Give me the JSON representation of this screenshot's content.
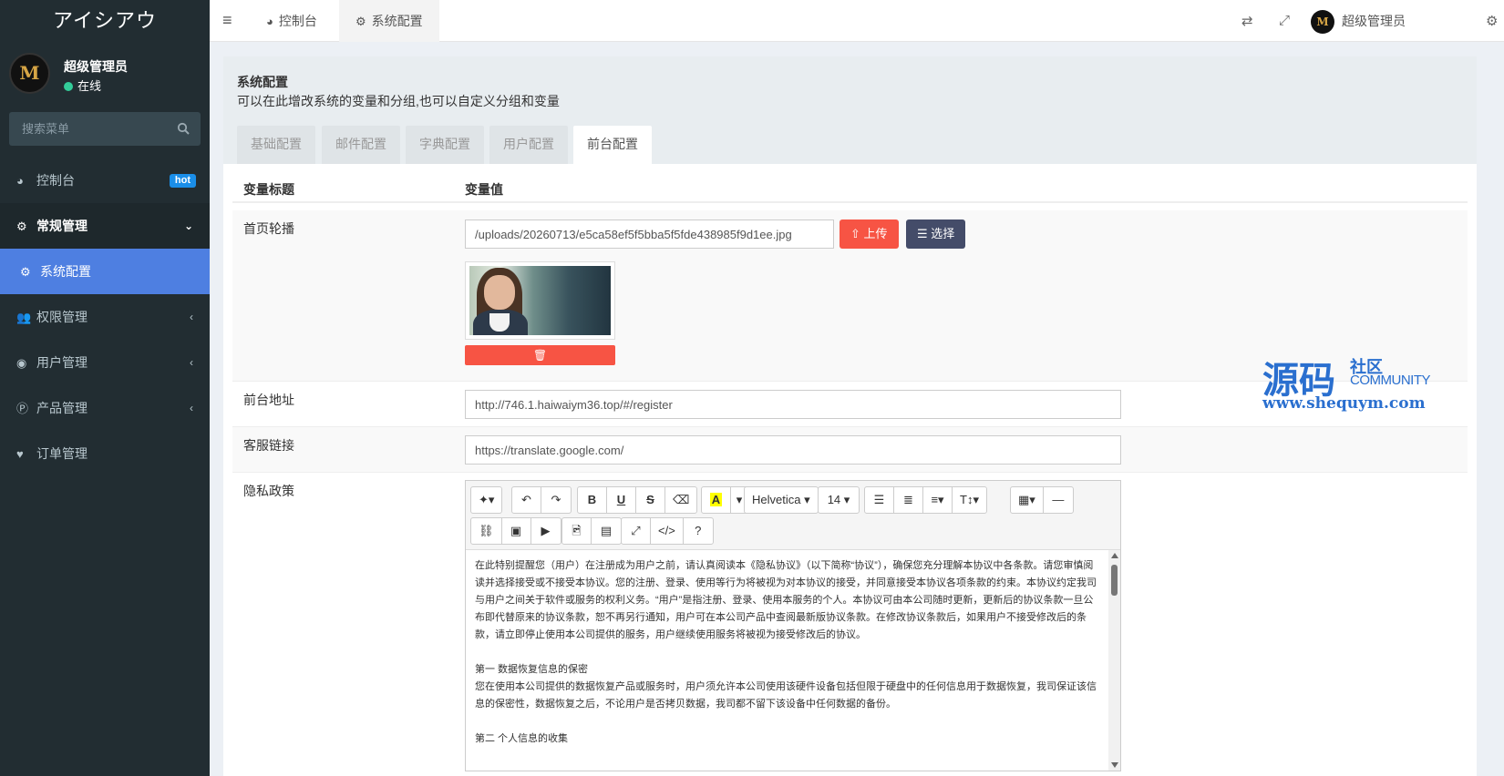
{
  "sidebar": {
    "app_title": "アイシアウ",
    "avatar_text": "M",
    "user_name": "超级管理员",
    "status": "在线",
    "search_placeholder": "搜索菜单",
    "items": [
      {
        "label": "控制台",
        "icon": "dashboard-icon",
        "badge": "hot"
      },
      {
        "label": "常规管理",
        "icon": "cogs-icon"
      },
      {
        "label": "系统配置",
        "icon": "gear-icon"
      },
      {
        "label": "权限管理",
        "icon": "users-icon"
      },
      {
        "label": "用户管理",
        "icon": "user-circle-icon"
      },
      {
        "label": "产品管理",
        "icon": "product-icon"
      },
      {
        "label": "订单管理",
        "icon": "heartbeat-icon"
      }
    ]
  },
  "topbar": {
    "tabs": [
      {
        "label": "控制台",
        "icon": "dashboard-icon"
      },
      {
        "label": "系统配置",
        "icon": "gear-icon"
      }
    ],
    "user_name": "超级管理员",
    "avatar_text": "M"
  },
  "panel": {
    "title": "系统配置",
    "description": "可以在此增改系统的变量和分组,也可以自定义分组和变量",
    "tabs": [
      "基础配置",
      "邮件配置",
      "字典配置",
      "用户配置",
      "前台配置"
    ],
    "active_tab": "前台配置"
  },
  "table": {
    "col_title": "变量标题",
    "col_value": "变量值",
    "rows": {
      "banner": {
        "label": "首页轮播",
        "value": "/uploads/20260713/e5ca58ef5f5bba5f5fde438985f9d1ee.jpg",
        "upload_label": "上传",
        "select_label": "选择"
      },
      "frontend_url": {
        "label": "前台地址",
        "value": "http://746.1.haiwaiym36.top/#/register"
      },
      "service_link": {
        "label": "客服链接",
        "value": "https://translate.google.com/"
      },
      "privacy": {
        "label": "隐私政策",
        "editor": {
          "font_name": "Helvetica",
          "font_size": "14",
          "paragraphs": [
            "在此特别提醒您（用户）在注册成为用户之前，请认真阅读本《隐私协议》（以下简称“协议”），确保您充分理解本协议中各条款。请您审慎阅读并选择接受或不接受本协议。您的注册、登录、使用等行为将被视为对本协议的接受，并同意接受本协议各项条款的约束。本协议约定我司与用户之间关于软件或服务的权利义务。“用户”是指注册、登录、使用本服务的个人。本协议可由本公司随时更新，更新后的协议条款一旦公布即代替原来的协议条款，恕不再另行通知，用户可在本公司产品中查阅最新版协议条款。在修改协议条款后，如果用户不接受修改后的条款，请立即停止使用本公司提供的服务，用户继续使用服务将被视为接受修改后的协议。",
            "",
            "第一 数据恢复信息的保密",
            "您在使用本公司提供的数据恢复产品或服务时，用户须允许本公司使用该硬件设备包括但限于硬盘中的任何信息用于数据恢复，我司保证该信息的保密性，数据恢复之后，不论用户是否拷贝数据，我司都不留下该设备中任何数据的备份。",
            "",
            "第二 个人信息的收集"
          ]
        }
      }
    }
  },
  "watermark": {
    "big": "源码",
    "small1": "社区",
    "small2": "COMMUNITY",
    "url": "www.shequym.com"
  },
  "colors": {
    "sidebar_bg": "#222d32",
    "active_menu": "#4e7fe1",
    "upload_btn": "#f75444",
    "select_btn": "#444c69",
    "hot_badge": "#1a8ee8",
    "watermark": "#2a6fcf"
  }
}
